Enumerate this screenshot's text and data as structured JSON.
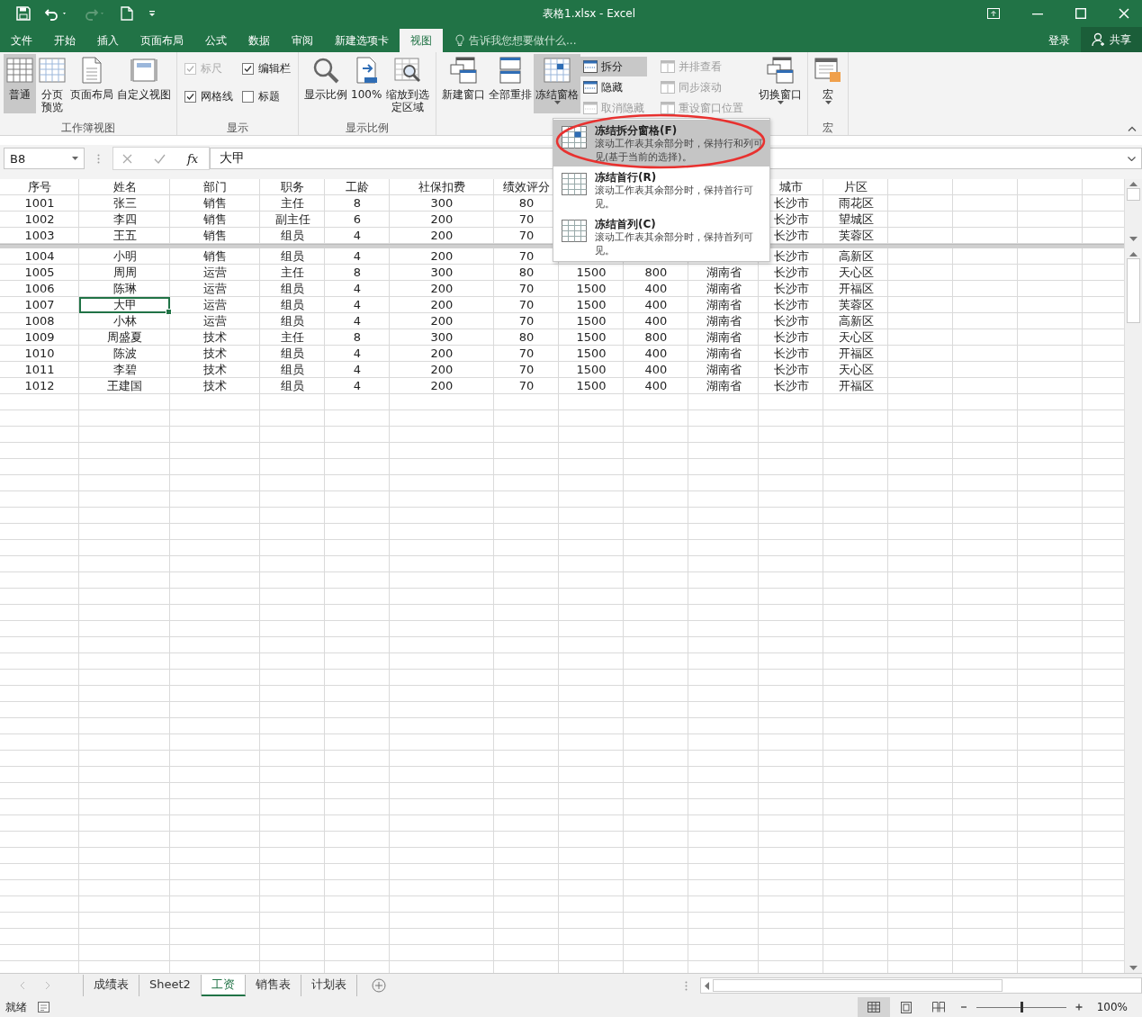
{
  "title_bar": {
    "title": "表格1.xlsx - Excel"
  },
  "menu_tabs": [
    {
      "label": "文件",
      "selected": false
    },
    {
      "label": "开始",
      "selected": false
    },
    {
      "label": "插入",
      "selected": false
    },
    {
      "label": "页面布局",
      "selected": false
    },
    {
      "label": "公式",
      "selected": false
    },
    {
      "label": "数据",
      "selected": false
    },
    {
      "label": "审阅",
      "selected": false
    },
    {
      "label": "新建选项卡",
      "selected": false
    },
    {
      "label": "视图",
      "selected": true
    }
  ],
  "tell_me": {
    "placeholder": "告诉我您想要做什么..."
  },
  "account": {
    "sign_in": "登录",
    "share": "共享"
  },
  "ribbon": {
    "groups": [
      {
        "label": "工作簿视图",
        "items": [
          {
            "kind": "large",
            "label": "普通",
            "selected": true,
            "has_menu": false
          },
          {
            "kind": "large",
            "label": "分页预览",
            "selected": false,
            "has_menu": false
          },
          {
            "kind": "large",
            "label": "页面布局",
            "selected": false,
            "has_menu": false
          },
          {
            "kind": "large",
            "label": "自定义视图",
            "selected": false,
            "has_menu": false
          }
        ]
      },
      {
        "label": "显示",
        "items": [
          {
            "kind": "check",
            "label": "标尺",
            "checked": true,
            "disabled": true
          },
          {
            "kind": "check",
            "label": "编辑栏",
            "checked": true,
            "disabled": false
          },
          {
            "kind": "check",
            "label": "网格线",
            "checked": true,
            "disabled": false
          },
          {
            "kind": "check",
            "label": "标题",
            "checked": false,
            "disabled": false
          }
        ]
      },
      {
        "label": "显示比例",
        "items": [
          {
            "kind": "large",
            "label": "显示比例",
            "selected": false,
            "has_menu": false
          },
          {
            "kind": "large",
            "label": "100%",
            "selected": false,
            "has_menu": false
          },
          {
            "kind": "large",
            "label": "缩放到选定区域",
            "selected": false,
            "has_menu": false
          }
        ]
      },
      {
        "items": [
          {
            "kind": "large",
            "label": "新建窗口",
            "selected": false,
            "has_menu": false
          },
          {
            "kind": "large",
            "label": "全部重排",
            "selected": false,
            "has_menu": false
          },
          {
            "kind": "large",
            "label": "冻结窗格",
            "selected": true,
            "has_menu": true
          },
          {
            "kind": "small",
            "label": "拆分",
            "selected": true,
            "disabled": false
          },
          {
            "kind": "small",
            "label": "隐藏",
            "selected": false,
            "disabled": false
          },
          {
            "kind": "small",
            "label": "取消隐藏",
            "selected": false,
            "disabled": true
          },
          {
            "kind": "small",
            "label": "并排查看",
            "selected": false,
            "disabled": true
          },
          {
            "kind": "small",
            "label": "同步滚动",
            "selected": false,
            "disabled": true
          },
          {
            "kind": "small",
            "label": "重设窗口位置",
            "selected": false,
            "disabled": true
          },
          {
            "kind": "large",
            "label": "切换窗口",
            "selected": false,
            "has_menu": true
          }
        ]
      },
      {
        "label": "宏",
        "items": [
          {
            "kind": "large",
            "label": "宏",
            "selected": false,
            "has_menu": true
          }
        ]
      }
    ]
  },
  "formula_bar": {
    "name_box": "B8",
    "function_label": "fx",
    "value": "大甲"
  },
  "sheet": {
    "frozen_rows": [
      {
        "cells": [
          "序号",
          "姓名",
          "部门",
          "职务",
          "工龄",
          "社保扣费",
          "绩效评分",
          null,
          null,
          null,
          "城市",
          "片区"
        ]
      },
      {
        "cells": [
          "1001",
          "张三",
          "销售",
          "主任",
          "8",
          "300",
          "80",
          null,
          null,
          null,
          "长沙市",
          "雨花区"
        ]
      },
      {
        "cells": [
          "1002",
          "李四",
          "销售",
          "副主任",
          "6",
          "200",
          "70",
          null,
          null,
          null,
          "长沙市",
          "望城区"
        ]
      },
      {
        "cells": [
          "1003",
          "王五",
          "销售",
          "组员",
          "4",
          "200",
          "70",
          null,
          null,
          null,
          "长沙市",
          "芙蓉区"
        ]
      }
    ],
    "rows": [
      {
        "cells": [
          "1004",
          "小明",
          "销售",
          "组员",
          "4",
          "200",
          "70",
          null,
          null,
          null,
          "长沙市",
          "高新区"
        ]
      },
      {
        "cells": [
          "1005",
          "周周",
          "运营",
          "主任",
          "8",
          "300",
          "80",
          "1500",
          "800",
          "湖南省",
          "长沙市",
          "天心区"
        ]
      },
      {
        "cells": [
          "1006",
          "陈琳",
          "运营",
          "组员",
          "4",
          "200",
          "70",
          "1500",
          "400",
          "湖南省",
          "长沙市",
          "开福区"
        ]
      },
      {
        "cells": [
          "1007",
          "大甲",
          "运营",
          "组员",
          "4",
          "200",
          "70",
          "1500",
          "400",
          "湖南省",
          "长沙市",
          "芙蓉区"
        ]
      },
      {
        "cells": [
          "1008",
          "小林",
          "运营",
          "组员",
          "4",
          "200",
          "70",
          "1500",
          "400",
          "湖南省",
          "长沙市",
          "高新区"
        ]
      },
      {
        "cells": [
          "1009",
          "周盛夏",
          "技术",
          "主任",
          "8",
          "300",
          "80",
          "1500",
          "800",
          "湖南省",
          "长沙市",
          "天心区"
        ]
      },
      {
        "cells": [
          "1010",
          "陈波",
          "技术",
          "组员",
          "4",
          "200",
          "70",
          "1500",
          "400",
          "湖南省",
          "长沙市",
          "开福区"
        ]
      },
      {
        "cells": [
          "1011",
          "李碧",
          "技术",
          "组员",
          "4",
          "200",
          "70",
          "1500",
          "400",
          "湖南省",
          "长沙市",
          "天心区"
        ]
      },
      {
        "cells": [
          "1012",
          "王建国",
          "技术",
          "组员",
          "4",
          "200",
          "70",
          "1500",
          "400",
          "湖南省",
          "长沙市",
          "开福区"
        ]
      }
    ]
  },
  "freeze_menu": {
    "items": [
      {
        "title": "冻结拆分窗格(F)",
        "description": "滚动工作表其余部分时，保持行和列可见(基于当前的选择)。",
        "selected": true
      },
      {
        "title": "冻结首行(R)",
        "description": "滚动工作表其余部分时，保持首行可见。",
        "selected": false
      },
      {
        "title": "冻结首列(C)",
        "description": "滚动工作表其余部分时，保持首列可见。",
        "selected": false
      }
    ]
  },
  "sheet_tabs": [
    {
      "label": "成绩表",
      "selected": false
    },
    {
      "label": "Sheet2",
      "selected": false
    },
    {
      "label": "工资",
      "selected": true
    },
    {
      "label": "销售表",
      "selected": false
    },
    {
      "label": "计划表",
      "selected": false
    }
  ],
  "status_bar": {
    "status": "就绪",
    "views": [
      {
        "selected": true
      },
      {
        "selected": false
      },
      {
        "selected": false
      }
    ],
    "zoom_slider": {
      "level": 0.5
    },
    "zoom": "100%"
  }
}
